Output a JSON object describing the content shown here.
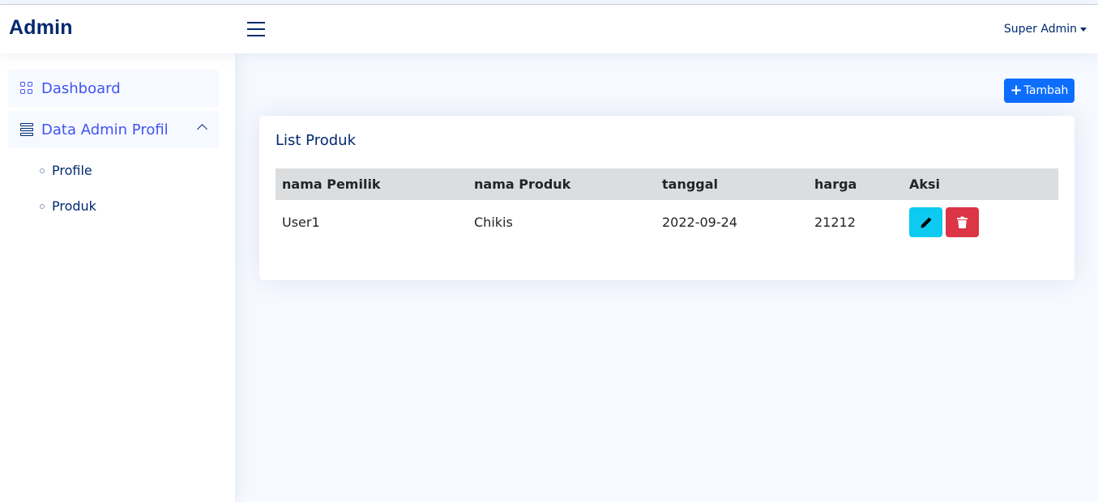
{
  "header": {
    "logo": "Admin",
    "user_name": "Super Admin"
  },
  "sidebar": {
    "dashboard": "Dashboard",
    "data_admin": "Data Admin Profil",
    "sub_items": [
      "Profile",
      "Produk"
    ]
  },
  "main": {
    "add_button": "Tambah",
    "card_title": "List Produk",
    "columns": [
      "nama Pemilik",
      "nama Produk",
      "tanggal",
      "harga",
      "Aksi"
    ],
    "rows": [
      {
        "owner": "User1",
        "product": "Chikis",
        "date": "2022-09-24",
        "price": "21212"
      }
    ]
  },
  "colors": {
    "primary": "#4154f1",
    "navy": "#012970",
    "blue_button": "#0d6efd",
    "info": "#0dcaf0",
    "danger": "#dc3545"
  },
  "icons": [
    "menu-icon",
    "grid-icon",
    "database-icon",
    "chevron-up-icon",
    "plus-icon",
    "pencil-icon",
    "trash-icon"
  ]
}
